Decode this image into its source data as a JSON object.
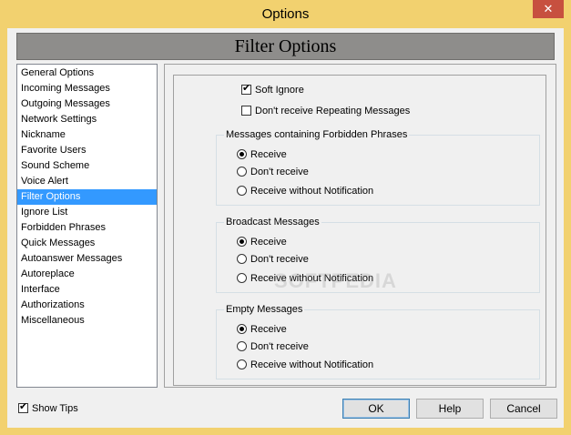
{
  "window": {
    "title": "Options",
    "close_glyph": "✕"
  },
  "header": {
    "title": "Filter Options"
  },
  "nav": {
    "items": [
      "General Options",
      "Incoming Messages",
      "Outgoing Messages",
      "Network Settings",
      "Nickname",
      "Favorite Users",
      "Sound Scheme",
      "Voice Alert",
      "Filter Options",
      "Ignore List",
      "Forbidden Phrases",
      "Quick Messages",
      "Autoanswer Messages",
      "Autoreplace",
      "Interface",
      "Authorizations",
      "Miscellaneous"
    ],
    "selected": "Filter Options"
  },
  "filter": {
    "soft_ignore": {
      "label": "Soft Ignore",
      "checked": true
    },
    "no_repeating": {
      "label": "Don't receive Repeating Messages",
      "checked": false
    },
    "groups": [
      {
        "title": "Messages containing Forbidden Phrases",
        "options": [
          "Receive",
          "Don't receive",
          "Receive without Notification"
        ],
        "selected": "Receive"
      },
      {
        "title": "Broadcast Messages",
        "options": [
          "Receive",
          "Don't receive",
          "Receive without Notification"
        ],
        "selected": "Receive"
      },
      {
        "title": "Empty Messages",
        "options": [
          "Receive",
          "Don't receive",
          "Receive without Notification"
        ],
        "selected": "Receive"
      }
    ]
  },
  "watermark": "SOFTPEDIA",
  "footer": {
    "show_tips": {
      "label": "Show Tips",
      "checked": true
    },
    "ok_label": "OK",
    "help_label": "Help",
    "cancel_label": "Cancel"
  },
  "colors": {
    "titlebar": "#f2d16f",
    "selection": "#3399ff",
    "header_bar": "#8e8d8b",
    "close_button": "#c7503f"
  }
}
